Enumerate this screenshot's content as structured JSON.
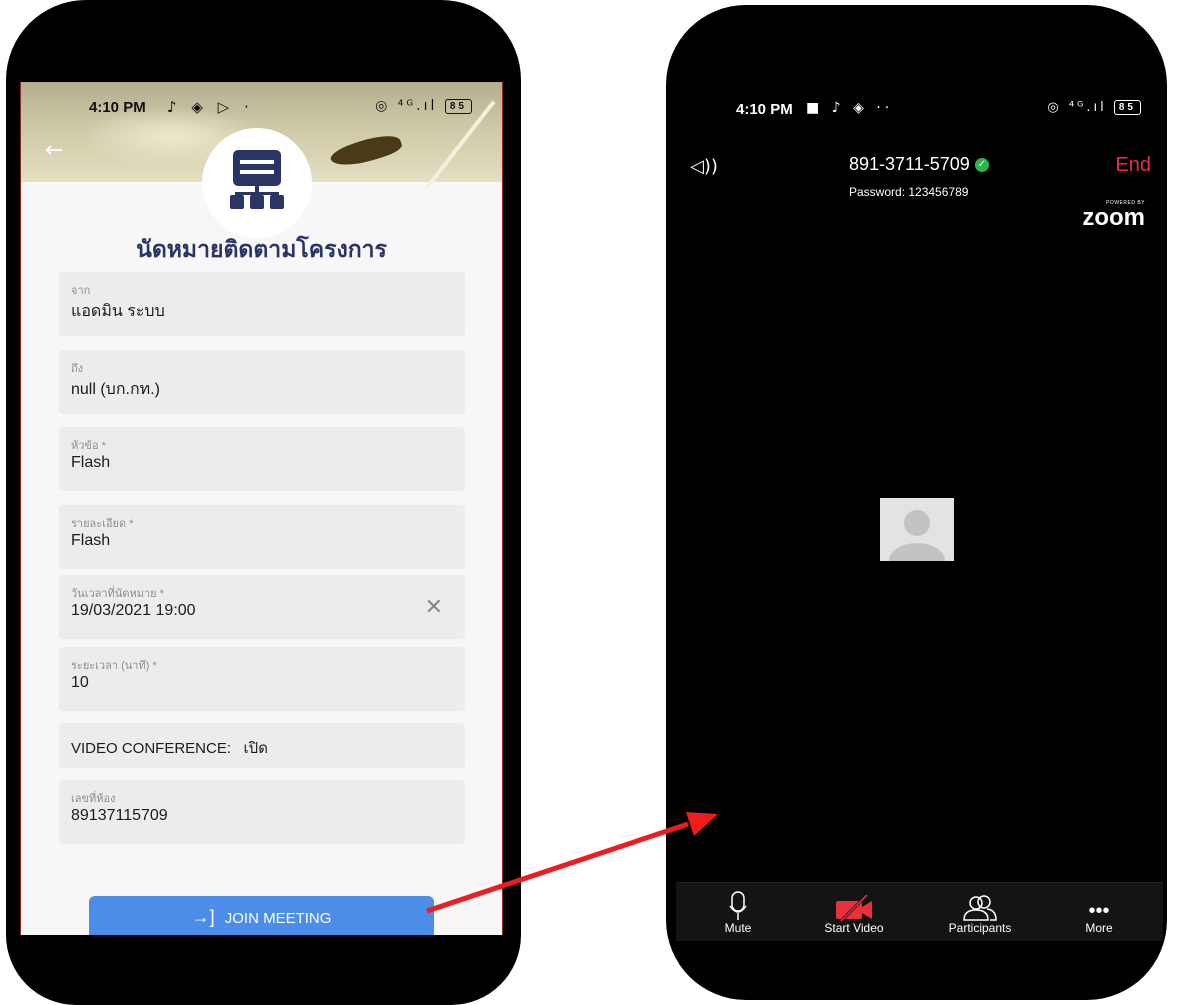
{
  "left_phone": {
    "status_bar": {
      "time": "4:10 PM",
      "icons": "♪ ◈ ▷ ·",
      "right_icons": "◎ ⁴ᴳ.ıl",
      "battery": "85"
    },
    "title": "นัดหมายติดตามโครงการ",
    "fields": {
      "from": {
        "label": "จาก",
        "value": "แอดมิน ระบบ"
      },
      "to": {
        "label": "ถึง",
        "value": "null (บก.กท.)"
      },
      "subject": {
        "label": "หัวข้อ *",
        "value": "Flash"
      },
      "detail": {
        "label": "รายละเอียด *",
        "value": "Flash"
      },
      "datetime": {
        "label": "วันเวลาที่นัดหมาย *",
        "value": "19/03/2021 19:00"
      },
      "duration": {
        "label": "ระยะเวลา (นาที) *",
        "value": "10"
      },
      "video_conf": {
        "label": "VIDEO CONFERENCE:",
        "value": "เปิด"
      },
      "room": {
        "label": "เลขที่ห้อง",
        "value": "89137115709"
      }
    },
    "join_button": "JOIN MEETING",
    "icons": {
      "back": "arrow-left-icon",
      "clear": "close-icon",
      "join": "login-icon"
    },
    "colors": {
      "title": "#2a3566",
      "join": "#4b8de9"
    }
  },
  "right_phone": {
    "status_bar": {
      "time": "4:10 PM",
      "icons": "■ ♪ ◈ ··",
      "right_icons": "◎ ⁴ᴳ.ıl",
      "battery": "85"
    },
    "meeting_id": "891-3711-5709",
    "password": "Password: 123456789",
    "end_label": "End",
    "powered_by": "POWERED BY",
    "brand": "zoom",
    "toolbar": [
      {
        "label": "Mute",
        "icon": "microphone-icon"
      },
      {
        "label": "Start Video",
        "icon": "video-off-icon"
      },
      {
        "label": "Participants",
        "icon": "participants-icon"
      },
      {
        "label": "More",
        "icon": "more-icon"
      }
    ],
    "colors": {
      "end": "#e8313a",
      "verified": "#27b84a",
      "video_off": "#e8313a"
    }
  },
  "annotation": {
    "arrow_color": "#ee1c1c"
  }
}
